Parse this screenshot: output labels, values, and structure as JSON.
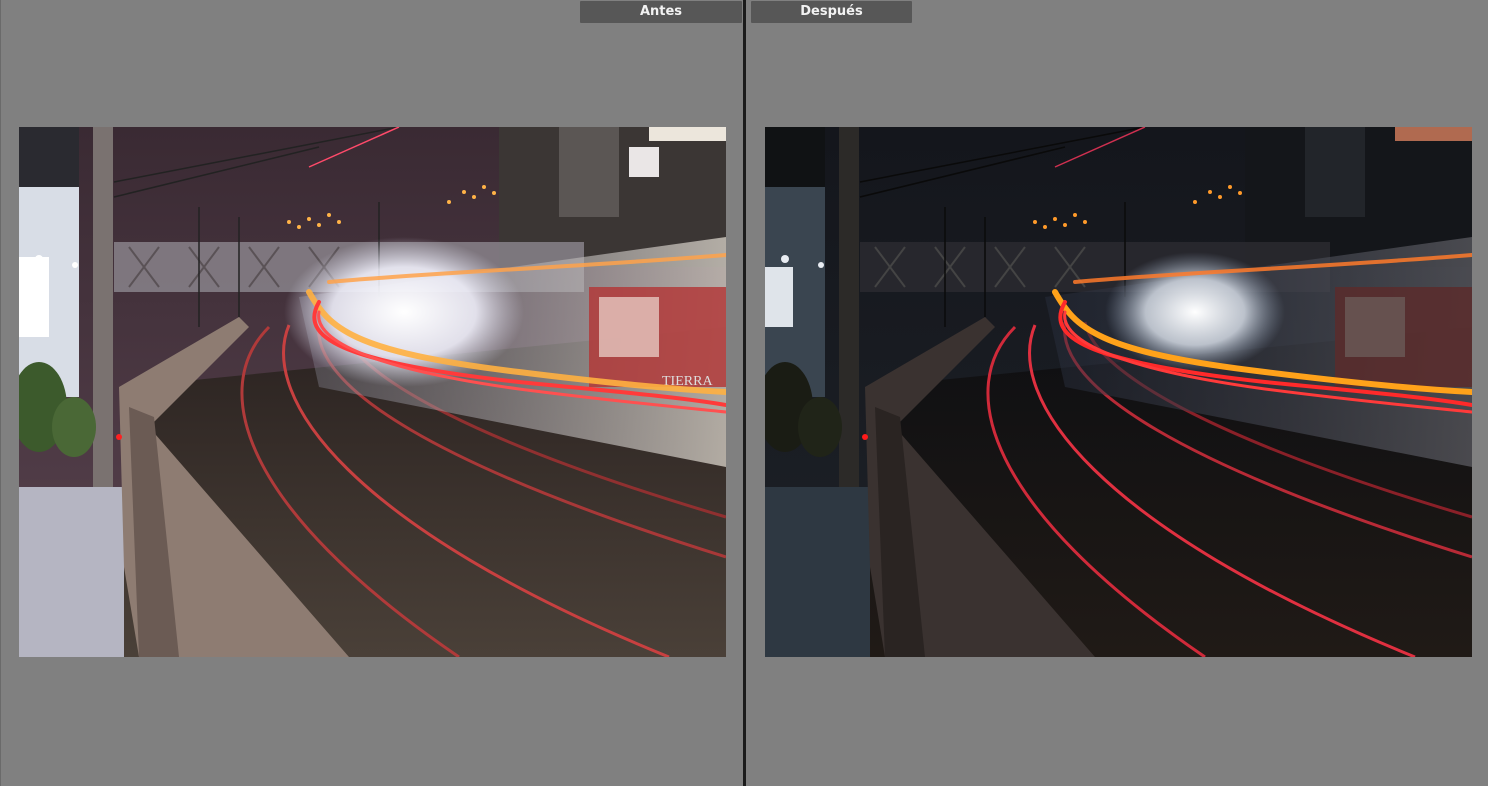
{
  "compare": {
    "before_label": "Antes",
    "after_label": "Después"
  },
  "photo": {
    "subject": "night railway long-exposure",
    "sign_text": "TIERRA"
  },
  "colors": {
    "background": "#808080",
    "label_bg": "#575757",
    "divider": "#1b1b1b",
    "trail_red": "#ff3a3a",
    "trail_orange": "#ffb040"
  }
}
